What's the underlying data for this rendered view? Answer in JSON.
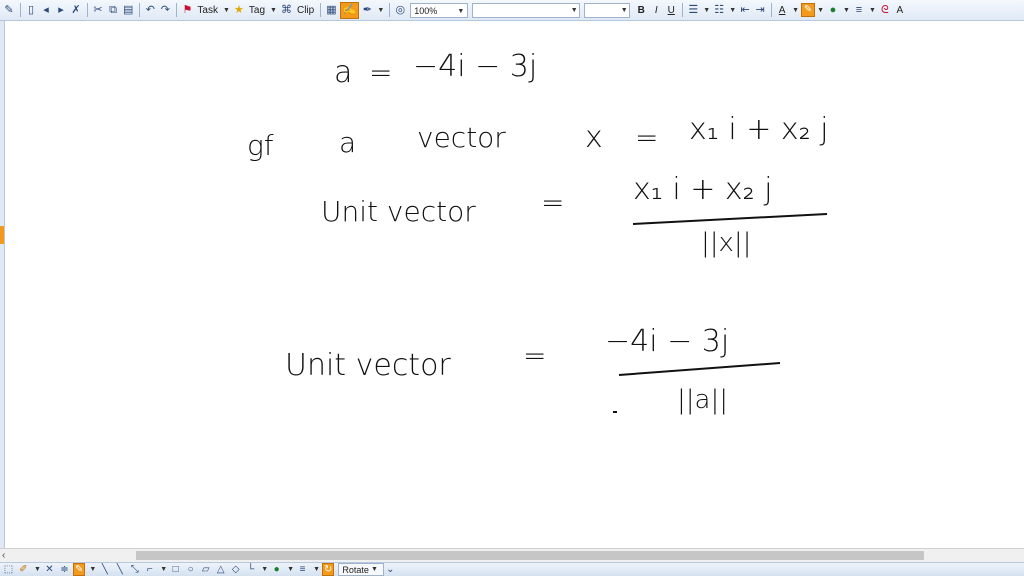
{
  "toolbar": {
    "task_label": "Task",
    "tag_label": "Tag",
    "clip_label": "Clip",
    "zoom_value": "100%",
    "font_name": "",
    "font_size": "",
    "bold": "B",
    "italic": "I",
    "underline": "U",
    "text_style": "A",
    "font_size_tool": "A",
    "highlight_color": "#f39a1c"
  },
  "canvas": {
    "line1": {
      "lhs": "a",
      "eq": "=",
      "rhs": "−4i − 3j"
    },
    "line2": {
      "prefix": "gf",
      "a": "a",
      "vector": "vector",
      "x": "x",
      "eq": "=",
      "rhs": "x₁ i + x₂ j"
    },
    "line3": {
      "lhs": "Unit vector",
      "eq": "=",
      "numerator": "x₁ i + x₂ j",
      "denominator": "||x||"
    },
    "line4": {
      "lhs": "Unit vector",
      "eq": "=",
      "numerator": "−4i − 3j",
      "denominator": "||a||"
    }
  },
  "bottom_toolbar": {
    "rotate_label": "Rotate"
  },
  "colors": {
    "accent": "#f39a1c",
    "toolbar_bg": "#dfe9f5",
    "ink": "#111111"
  }
}
